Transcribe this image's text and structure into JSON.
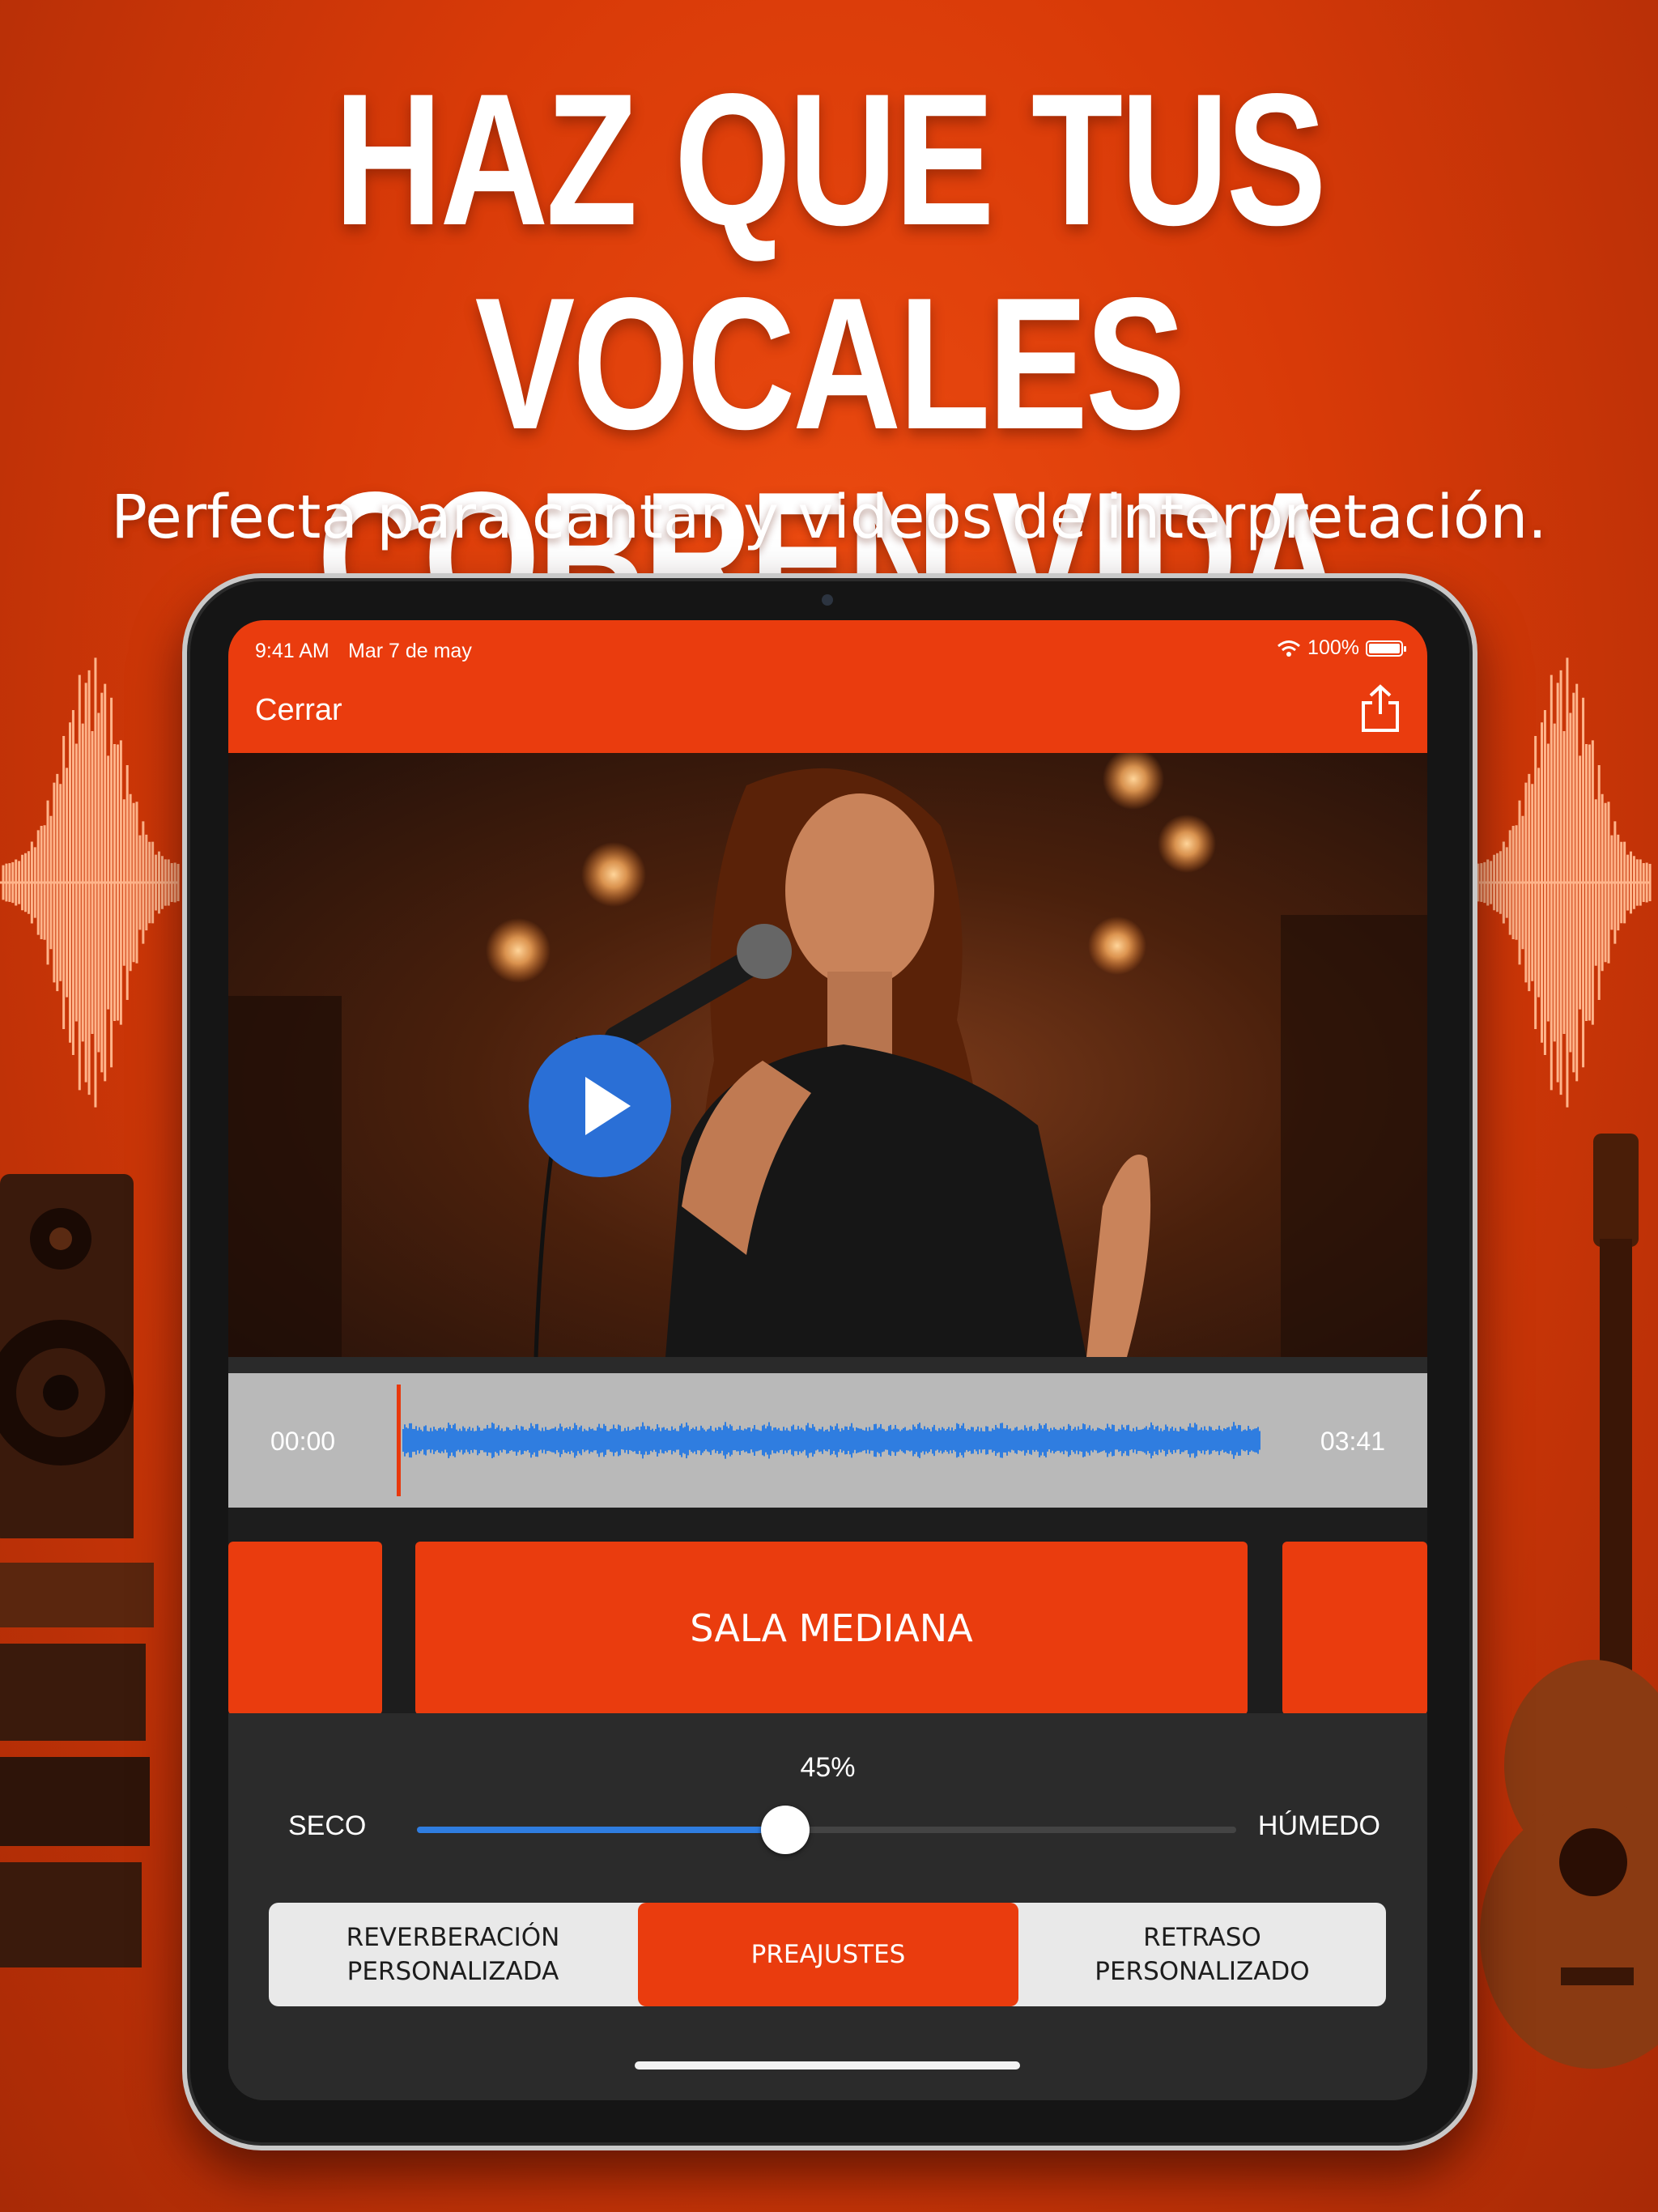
{
  "promo": {
    "headline_line1": "HAZ QUE TUS",
    "headline_line2": "VOCALES COBREN VIDA",
    "subtitle": "Perfecta para cantar y videos de interpretación."
  },
  "status_bar": {
    "time": "9:41 AM",
    "date": "Mar 7 de may",
    "battery": "100%"
  },
  "nav": {
    "close_label": "Cerrar",
    "share_icon": "share-icon"
  },
  "player": {
    "play_icon": "play-icon",
    "start_time": "00:00",
    "end_time": "03:41",
    "waveform_color": "#2f7de0",
    "playhead_color": "#e8380c"
  },
  "preset": {
    "current": "SALA MEDIANA"
  },
  "mix": {
    "value_label": "45%",
    "value_fraction": 0.45,
    "left_label": "SECO",
    "right_label": "HÚMEDO"
  },
  "tabs": [
    {
      "label": "REVERBERACIÓN\nPERSONALIZADA",
      "selected": false
    },
    {
      "label": "PREAJUSTES",
      "selected": true
    },
    {
      "label": "RETRASO\nPERSONALIZADO",
      "selected": false
    }
  ],
  "colors": {
    "accent": "#ea3c0e",
    "slider": "#2f7de0",
    "play_button": "#2a6fd6"
  }
}
